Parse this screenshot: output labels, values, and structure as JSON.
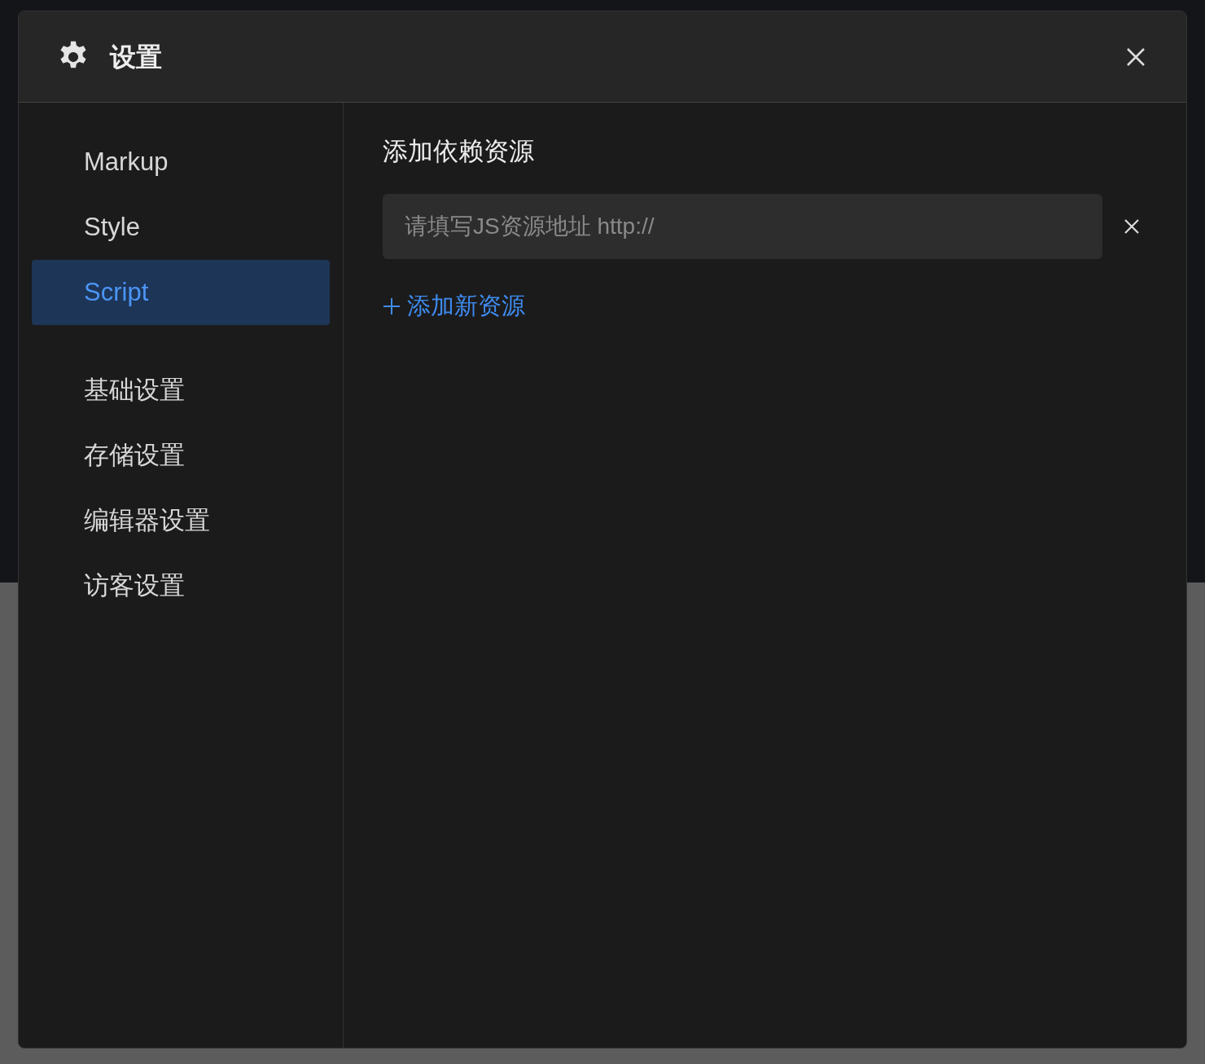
{
  "dialog": {
    "title": "设置"
  },
  "sidebar": {
    "groups": [
      {
        "items": [
          {
            "label": "Markup",
            "selected": false
          },
          {
            "label": "Style",
            "selected": false
          },
          {
            "label": "Script",
            "selected": true
          }
        ]
      },
      {
        "items": [
          {
            "label": "基础设置",
            "selected": false
          },
          {
            "label": "存储设置",
            "selected": false
          },
          {
            "label": "编辑器设置",
            "selected": false
          },
          {
            "label": "访客设置",
            "selected": false
          }
        ]
      }
    ]
  },
  "content": {
    "heading": "添加依赖资源",
    "resources": [
      {
        "placeholder": "请填写JS资源地址 http://"
      }
    ],
    "add_button": "添加新资源"
  }
}
